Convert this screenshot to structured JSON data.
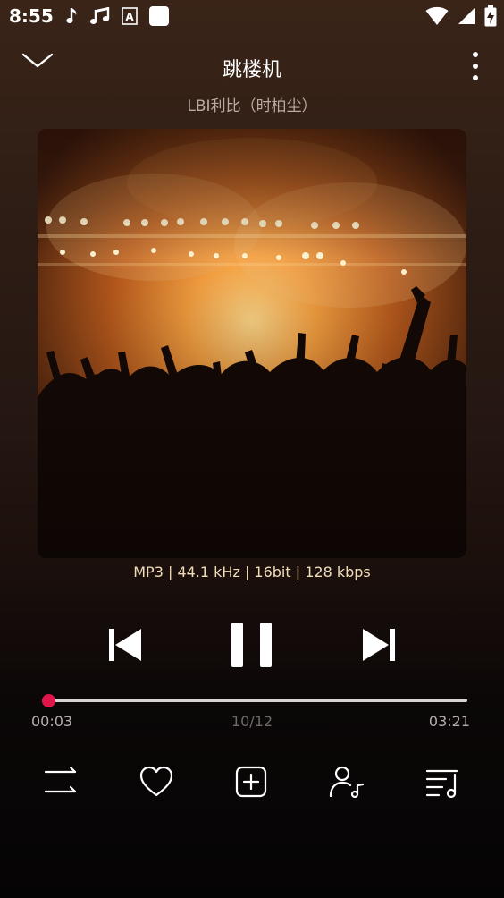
{
  "status_bar": {
    "time": "8:55",
    "left_icons": [
      "music-note-icon",
      "music-notes-icon",
      "font-a-icon",
      "white-square-icon"
    ],
    "right_icons": [
      "wifi-icon",
      "signal-icon",
      "battery-charging-icon"
    ]
  },
  "player": {
    "title": "跳楼机",
    "artist": "LBI利比（时柏尘）",
    "album_art": "concert-crowd-image",
    "audio_info": "MP3 | 44.1 kHz | 16bit | 128 kbps",
    "progress_fraction": 0.016,
    "current_time": "00:03",
    "track_index": "10/12",
    "total_time": "03:21"
  },
  "colors": {
    "accent": "#e0164b",
    "audio_info_text": "#f0ddb8",
    "secondary_text": "#b9aaa3"
  },
  "controls": [
    "previous-icon",
    "pause-icon",
    "next-icon"
  ],
  "actions": [
    "repeat-icon",
    "heart-icon",
    "add-to-playlist-icon",
    "artist-icon",
    "queue-icon"
  ]
}
